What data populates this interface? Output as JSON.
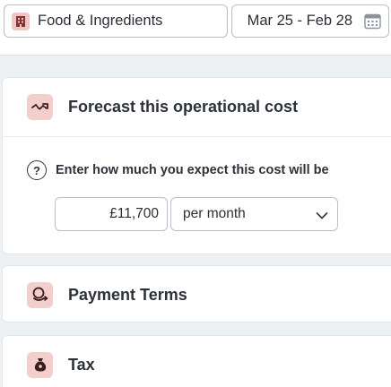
{
  "top_bar": {
    "category": {
      "label": "Food & Ingredients",
      "icon": "building-icon"
    },
    "date_range": {
      "label": "Mar 25 - Feb 28",
      "icon": "calendar-icon"
    }
  },
  "forecast_card": {
    "title": "Forecast this operational cost",
    "icon": "trend-icon",
    "question": "Enter how much you expect this cost will be",
    "question_icon": "?",
    "amount": "£11,700",
    "period": "per month"
  },
  "payment_card": {
    "title": "Payment Terms",
    "icon": "payment-icon"
  },
  "tax_card": {
    "title": "Tax",
    "icon": "money-bag-icon"
  },
  "colors": {
    "accent_bg": "#f2cfcd",
    "accent_icon": "#8b2e2e",
    "page_bg": "#eef1f4"
  }
}
